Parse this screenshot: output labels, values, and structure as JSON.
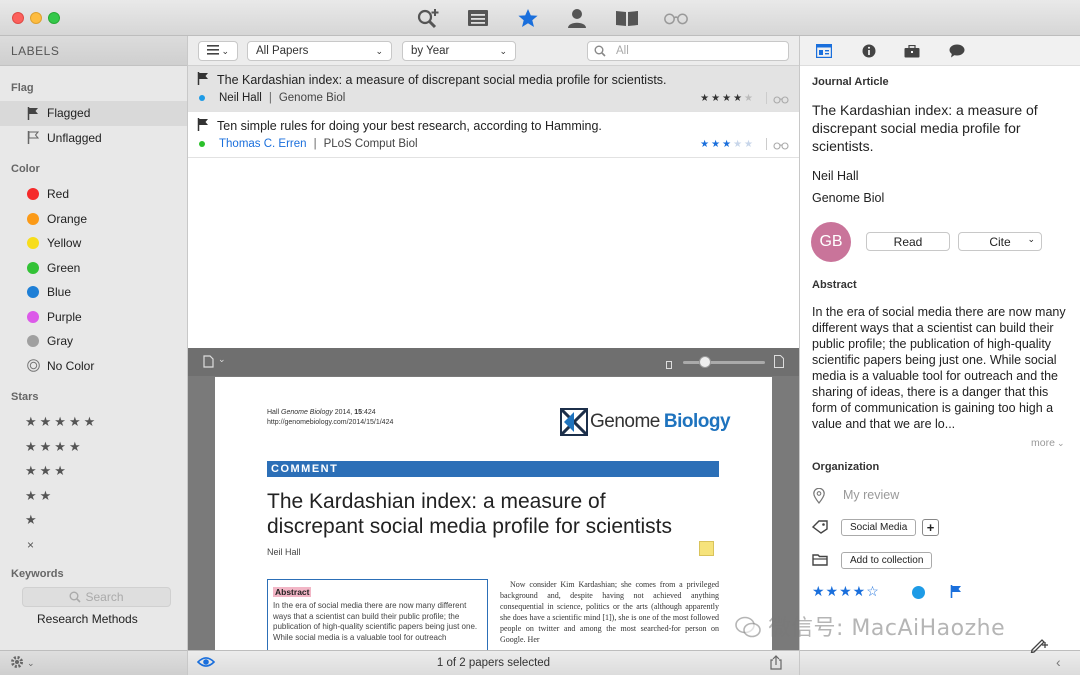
{
  "toolbar": {
    "icons": [
      "search-add-icon",
      "library-icon",
      "star-icon",
      "person-icon",
      "book-icon",
      "glasses-icon"
    ]
  },
  "sidebar": {
    "header": "LABELS",
    "flag_section": "Flag",
    "flag_items": [
      "Flagged",
      "Unflagged"
    ],
    "color_section": "Color",
    "colors": [
      {
        "label": "Red",
        "color": "#f52a2a"
      },
      {
        "label": "Orange",
        "color": "#fb9a17"
      },
      {
        "label": "Yellow",
        "color": "#f7dd1b"
      },
      {
        "label": "Green",
        "color": "#33c236"
      },
      {
        "label": "Blue",
        "color": "#1e7fd6"
      },
      {
        "label": "Purple",
        "color": "#dc5ae9"
      },
      {
        "label": "Gray",
        "color": "#a0a0a0"
      },
      {
        "label": "No Color",
        "color": ""
      }
    ],
    "stars_section": "Stars",
    "star_rows": [
      "★★★★★",
      "★★★★",
      "★★★",
      "★★",
      "★",
      "×"
    ],
    "keywords_section": "Keywords",
    "search_placeholder": "Search",
    "keyword_items": [
      "Research Methods"
    ]
  },
  "filterbar": {
    "collection": "All Papers",
    "sort": "by Year",
    "search_placeholder": "All"
  },
  "papers": [
    {
      "title": "The Kardashian index: a measure of discrepant social media profile for scientists.",
      "author": "Neil Hall",
      "journal": "Genome Biol",
      "rating": 4,
      "unread_color": "#1e9be6"
    },
    {
      "title": "Ten simple rules for doing your best research, according to Hamming.",
      "author": "Thomas C. Erren",
      "journal": "PLoS Comput Biol",
      "rating": 3,
      "unread_color": "#2bc12b"
    }
  ],
  "pdf": {
    "citation_line1": "Hall Genome Biology 2014, 15:424",
    "citation_line2": "http://genomebiology.com/2014/15/1/424",
    "logo_genome": "Genome",
    "logo_biology": "Biology",
    "section": "COMMENT",
    "title": "The Kardashian index: a measure of discrepant social media profile for scientists",
    "author": "Neil Hall",
    "abstract_label": "Abstract",
    "abstract_text": "In the era of social media there are now many different ways that a scientist can build their public profile; the publication of high-quality scientific papers being just one. While social media is a valuable tool for outreach",
    "body_text": "Now consider Kim Kardashian; she comes from a privileged background and, despite having not achieved anything consequential in science, politics or the arts (although apparently she does have a scientific mind [1]), she is one of the most followed people on twitter and among the most searched-for person on Google. Her"
  },
  "status": "1 of 2 papers selected",
  "inspector": {
    "type": "Journal Article",
    "title": "The Kardashian index: a measure of discrepant social media profile for scientists.",
    "author": "Neil Hall",
    "journal": "Genome Biol",
    "avatar_initials": "GB",
    "read_label": "Read",
    "cite_label": "Cite",
    "abstract_heading": "Abstract",
    "abstract": "In the era of social media there are now many different ways that a scientist can build their public profile; the publication of high-quality scientific papers being just one. While social media is a valuable tool for outreach and the sharing of ideas, there is a danger that this form of communication is gaining too high a value and that we are lo...",
    "more_label": "more",
    "organization_heading": "Organization",
    "review_placeholder": "My review",
    "tag": "Social Media",
    "add_collection_label": "Add to collection",
    "rating_stars": "★★★★☆"
  },
  "watermark": "微信号: MacAiHaozhe"
}
